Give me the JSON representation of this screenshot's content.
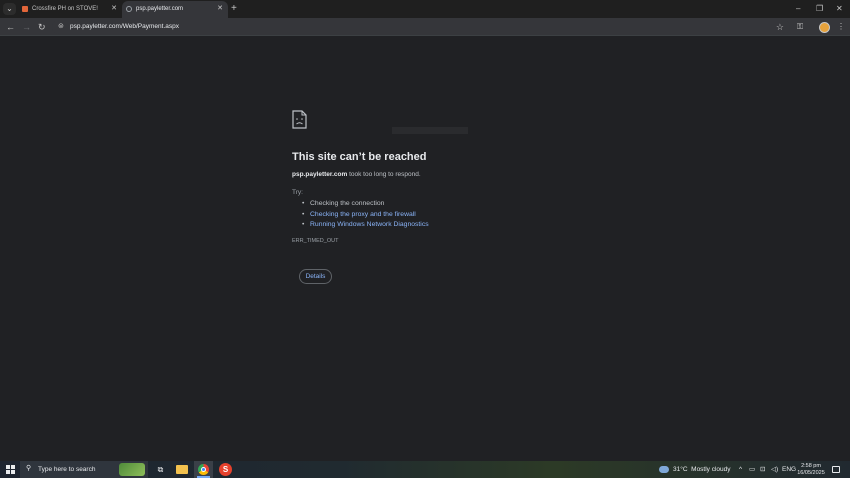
{
  "tabs": [
    {
      "title": "Crossfire PH on STOVE!",
      "favicon": "stove-favicon-icon",
      "active": false
    },
    {
      "title": "psp.payletter.com",
      "favicon": "globe-icon",
      "active": true
    }
  ],
  "window_controls": {
    "minimize": "–",
    "restore": "❐",
    "close": "✕"
  },
  "toolbar": {
    "url": "psp.payletter.com/Web/Payment.aspx",
    "icons": [
      "back-icon",
      "forward-icon",
      "reload-icon",
      "site-info-icon",
      "star-icon",
      "extensions-icon",
      "profile-avatar",
      "menu-icon"
    ]
  },
  "error_page": {
    "heading": "This site can’t be reached",
    "host": "psp.payletter.com",
    "description_suffix": " took too long to respond.",
    "try_label": "Try:",
    "suggestions": [
      "Checking the connection",
      "Checking the proxy and the firewall",
      "Running Windows Network Diagnostics"
    ],
    "error_code": "ERR_TIMED_OUT",
    "details_button": "Details"
  },
  "taskbar": {
    "search_placeholder": "Type here to search",
    "weather": {
      "temp": "31°C",
      "condition": "Mostly cloudy"
    },
    "language": "ENG",
    "time": "2:58 pm",
    "date": "16/05/2025"
  },
  "colors": {
    "background": "#202124",
    "link": "#8ab4f8",
    "heading": "#e8eaed",
    "tab_inactive_favicon": "#e2663a"
  }
}
